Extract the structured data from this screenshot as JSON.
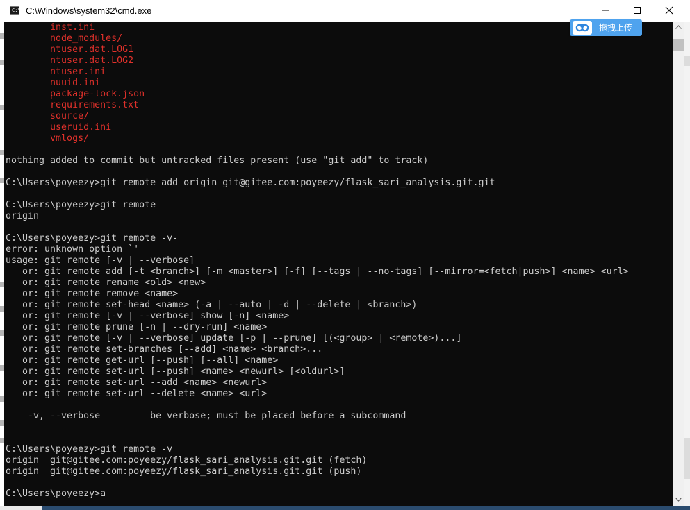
{
  "window": {
    "title": "C:\\Windows\\system32\\cmd.exe",
    "icon": "cmd-icon",
    "icon_prompt": "C:\\"
  },
  "controls": {
    "minimize_icon": "minimize-icon",
    "maximize_icon": "maximize-icon",
    "close_icon": "close-icon"
  },
  "overlay": {
    "upload_label": "拖拽上传",
    "upload_icon": "baidu-cloud-icon",
    "color": "#4fa3ee"
  },
  "console": {
    "background": "#0c0c0c",
    "foreground": "#cccccc",
    "untracked_color": "#e0312b",
    "untracked_files": [
      "inst.ini",
      "node_modules/",
      "ntuser.dat.LOG1",
      "ntuser.dat.LOG2",
      "ntuser.ini",
      "nuuid.ini",
      "package-lock.json",
      "requirements.txt",
      "source/",
      "useruid.ini",
      "vmlogs/"
    ],
    "lines": [
      "",
      "nothing added to commit but untracked files present (use \"git add\" to track)",
      "",
      "C:\\Users\\poyeezy>git remote add origin git@gitee.com:poyeezy/flask_sari_analysis.git.git",
      "",
      "C:\\Users\\poyeezy>git remote",
      "origin",
      "",
      "C:\\Users\\poyeezy>git remote -v-",
      "error: unknown option `'",
      "usage: git remote [-v | --verbose]",
      "   or: git remote add [-t <branch>] [-m <master>] [-f] [--tags | --no-tags] [--mirror=<fetch|push>] <name> <url>",
      "   or: git remote rename <old> <new>",
      "   or: git remote remove <name>",
      "   or: git remote set-head <name> (-a | --auto | -d | --delete | <branch>)",
      "   or: git remote [-v | --verbose] show [-n] <name>",
      "   or: git remote prune [-n | --dry-run] <name>",
      "   or: git remote [-v | --verbose] update [-p | --prune] [(<group> | <remote>)...]",
      "   or: git remote set-branches [--add] <name> <branch>...",
      "   or: git remote get-url [--push] [--all] <name>",
      "   or: git remote set-url [--push] <name> <newurl> [<oldurl>]",
      "   or: git remote set-url --add <name> <newurl>",
      "   or: git remote set-url --delete <name> <url>",
      "",
      "    -v, --verbose         be verbose; must be placed before a subcommand",
      "",
      "",
      "C:\\Users\\poyeezy>git remote -v",
      "origin  git@gitee.com:poyeezy/flask_sari_analysis.git.git (fetch)",
      "origin  git@gitee.com:poyeezy/flask_sari_analysis.git.git (push)",
      "",
      "C:\\Users\\poyeezy>a"
    ]
  },
  "scrollbar": {
    "up_icon": "scroll-up-arrow-icon",
    "down_icon": "scroll-down-arrow-icon"
  }
}
